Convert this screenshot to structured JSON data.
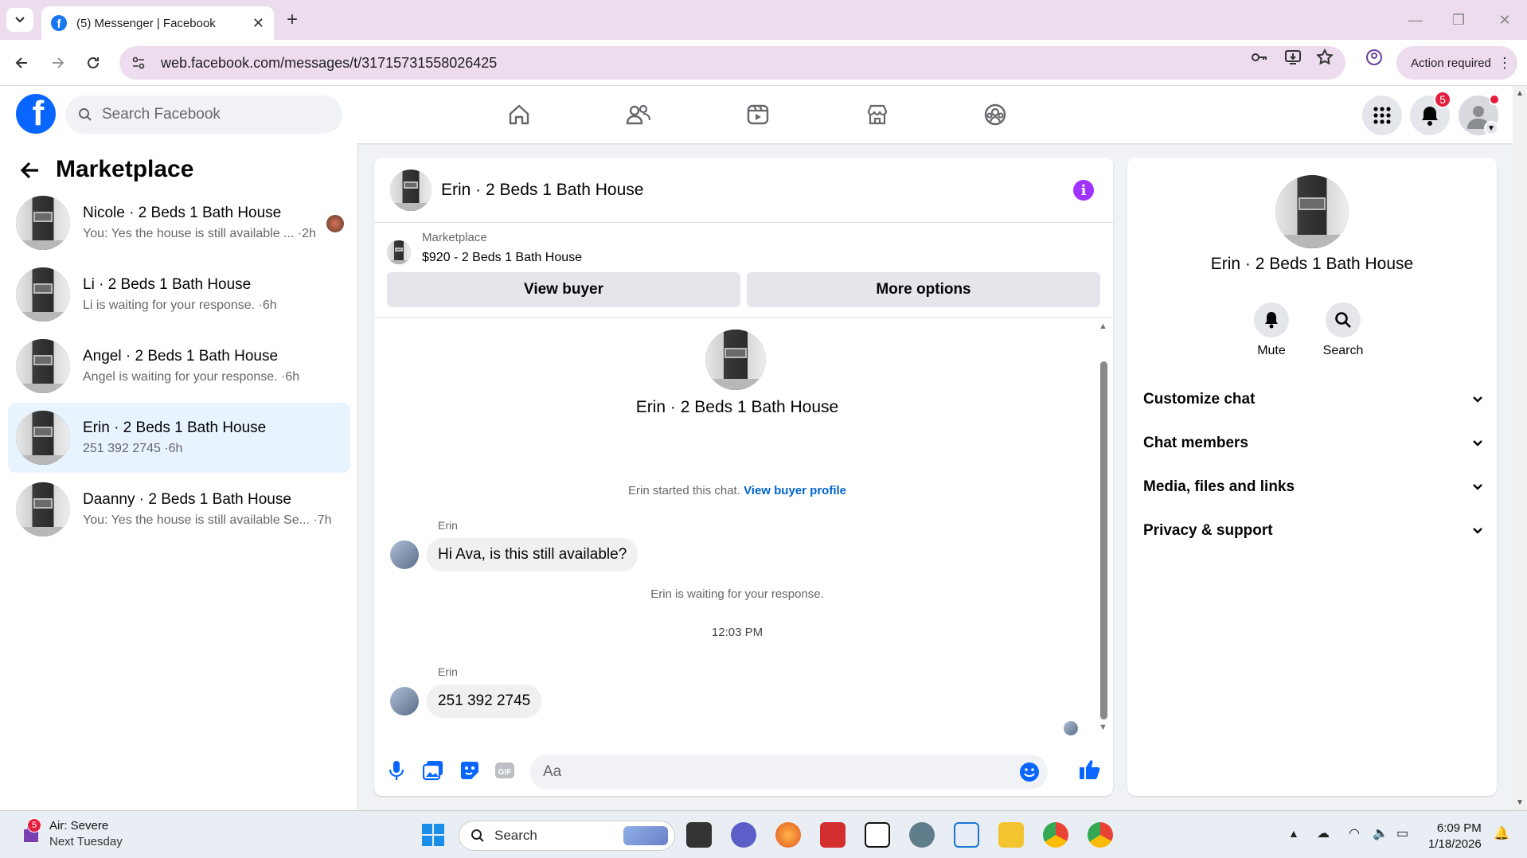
{
  "browser": {
    "tab_title": "(5) Messenger | Facebook",
    "url": "web.facebook.com/messages/t/31715731558026425",
    "action_required": "Action required"
  },
  "fb": {
    "search_placeholder": "Search Facebook",
    "notification_count": "5"
  },
  "sidebar": {
    "title": "Marketplace",
    "conversations": [
      {
        "name": "Nicole · 2 Beds 1 Bath House",
        "preview": "You: Yes the house is still available ... ·2h"
      },
      {
        "name": "Li · 2 Beds 1 Bath House",
        "preview": "Li is waiting for your response. ·6h"
      },
      {
        "name": "Angel · 2 Beds 1 Bath House",
        "preview": "Angel is waiting for your response. ·6h"
      },
      {
        "name": "Erin · 2 Beds 1 Bath House",
        "preview": "251 392 2745 ·6h"
      },
      {
        "name": "Daanny · 2 Beds 1 Bath House",
        "preview": "You: Yes the house is still available Se... ·7h"
      }
    ]
  },
  "chat": {
    "title": "Erin · 2 Beds 1 Bath House",
    "marketplace_label": "Marketplace",
    "listing": "$920 - 2 Beds 1 Bath House",
    "view_buyer": "View buyer",
    "more_options": "More options",
    "center_name": "Erin · 2 Beds 1 Bath House",
    "started_text": "Erin started this chat.",
    "view_buyer_profile": "View buyer profile",
    "messages": [
      {
        "sender": "Erin",
        "text": "Hi Ava, is this still available?"
      },
      {
        "sender": "Erin",
        "text": "251 392 2745"
      }
    ],
    "waiting_text": "Erin is waiting for your response.",
    "timestamp": "12:03 PM",
    "composer_placeholder": "Aa"
  },
  "info_panel": {
    "name": "Erin · 2 Beds 1 Bath House",
    "mute": "Mute",
    "search": "Search",
    "sections": [
      "Customize chat",
      "Chat members",
      "Media, files and links",
      "Privacy & support"
    ]
  },
  "taskbar": {
    "weather_badge": "5",
    "weather_title": "Air: Severe",
    "weather_sub": "Next Tuesday",
    "search": "Search",
    "time": "6:09 PM",
    "date": "1/18/2026"
  }
}
